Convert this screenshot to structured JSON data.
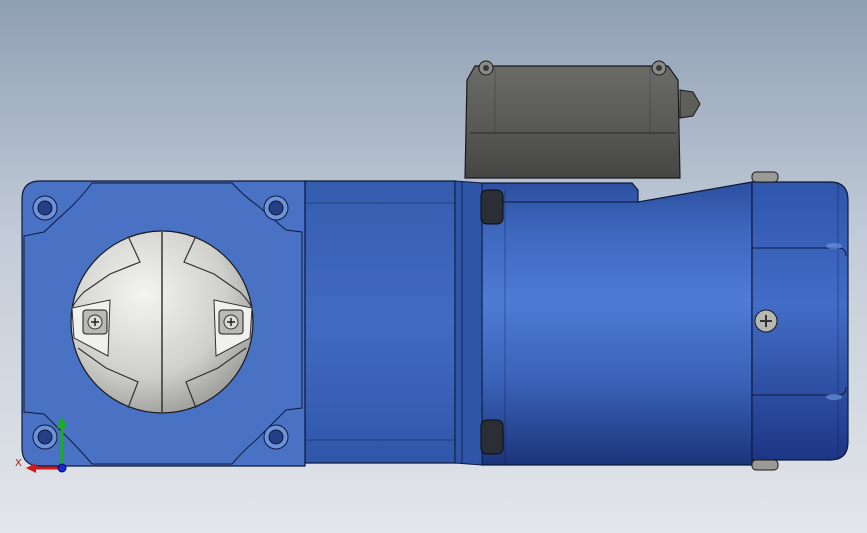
{
  "viewport": {
    "background_top": "#8f9fb4",
    "background_bottom": "#e3e6ea"
  },
  "model": {
    "flange_color": "#4a72c4",
    "housing_color": "#3b63b5",
    "motor_body_color": "#4470c9",
    "endcap_color": "#3b61b8",
    "shaft_face_color": "#dadada",
    "terminal_box_color": "#5a5a58",
    "edge_color": "#0d1a3a"
  },
  "triad": {
    "x_label": "X",
    "x_color": "#d01818",
    "y_color": "#18b018",
    "z_color": "#1828d0"
  }
}
